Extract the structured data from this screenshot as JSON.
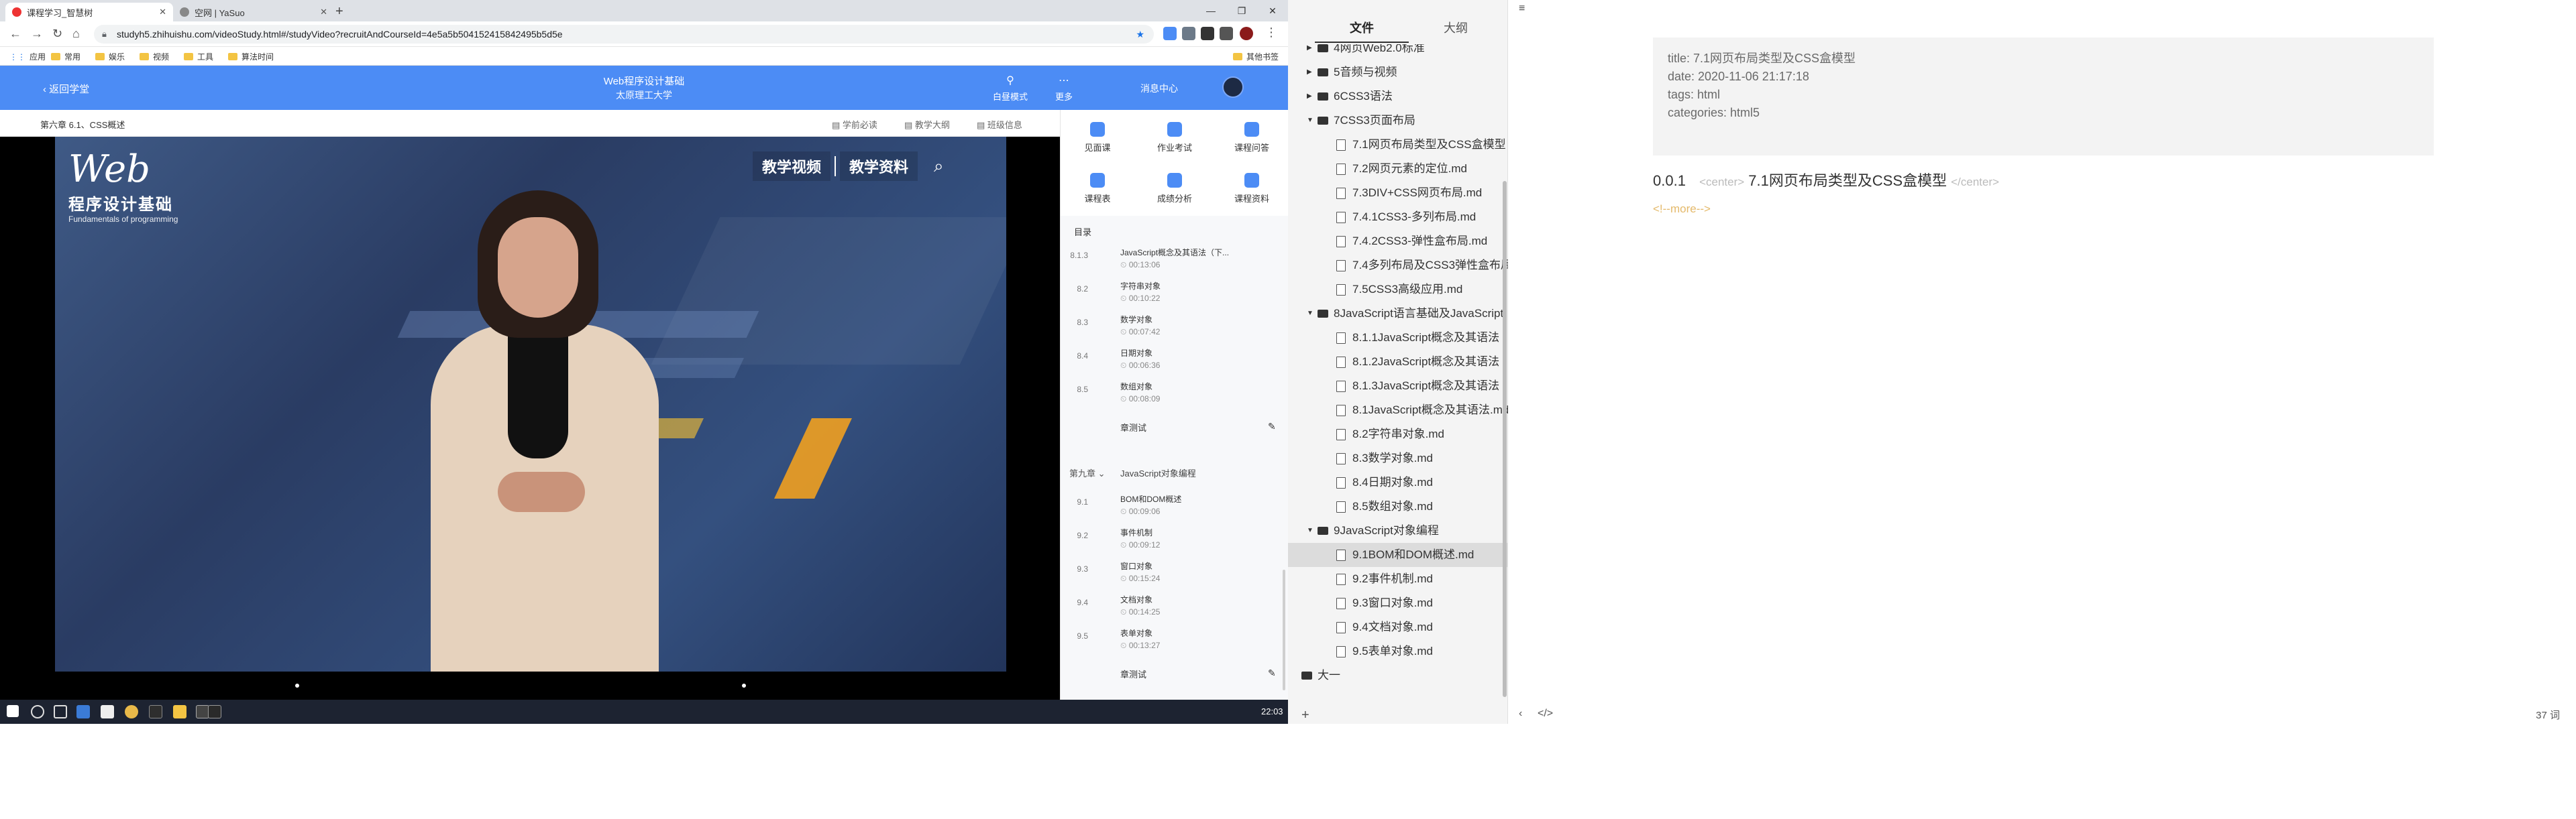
{
  "browser": {
    "tabs": [
      {
        "title": "课程学习_智慧树",
        "icon": "zhihuishu-icon"
      },
      {
        "title": "空网 | YaSuo",
        "icon": "globe-icon"
      }
    ],
    "url": "studyh5.zhihuishu.com/videoStudy.html#/studyVideo?recruitAndCourseId=4e5a5b504152415842495b5d5e",
    "bookmarks": [
      "应用",
      "常用",
      "娱乐",
      "视频",
      "工具",
      "算法时间"
    ],
    "bookmarks_right": "其他书签"
  },
  "site": {
    "back_label": "返回学堂",
    "course_title": "Web程序设计基础",
    "school": "太原理工大学",
    "mode_label": "白昼模式",
    "more_label": "更多",
    "message_center": "消息中心"
  },
  "chapter_bar": {
    "crumb": "第六章 6.1、CSS概述",
    "buttons": [
      "学前必读",
      "教学大纲",
      "班级信息"
    ]
  },
  "video": {
    "logo_word": "Web",
    "logo_cn": "程序设计基础",
    "logo_en": "Fundamentals of programming",
    "tab1": "教学视频",
    "tab2": "教学资料",
    "search_icon": "search-icon"
  },
  "quick": [
    {
      "label": "见面课"
    },
    {
      "label": "作业考试"
    },
    {
      "label": "课程问答"
    },
    {
      "label": "课程表"
    },
    {
      "label": "成绩分析"
    },
    {
      "label": "课程资料"
    }
  ],
  "toc": {
    "heading": "目录",
    "sections_a": [
      {
        "num": "8.1.3",
        "title": "JavaScript概念及其语法（下...",
        "dur": "00:13:06"
      },
      {
        "num": "8.2",
        "title": "字符串对象",
        "dur": "00:10:22"
      },
      {
        "num": "8.3",
        "title": "数学对象",
        "dur": "00:07:42"
      },
      {
        "num": "8.4",
        "title": "日期对象",
        "dur": "00:06:36"
      },
      {
        "num": "8.5",
        "title": "数组对象",
        "dur": "00:08:09"
      }
    ],
    "test_label": "章测试",
    "chapter9": {
      "label": "第九章",
      "title": "JavaScript对象编程"
    },
    "sections_b": [
      {
        "num": "9.1",
        "title": "BOM和DOM概述",
        "dur": "00:09:06"
      },
      {
        "num": "9.2",
        "title": "事件机制",
        "dur": "00:09:12"
      },
      {
        "num": "9.3",
        "title": "窗口对象",
        "dur": "00:15:24"
      },
      {
        "num": "9.4",
        "title": "文档对象",
        "dur": "00:14:25"
      },
      {
        "num": "9.5",
        "title": "表单对象",
        "dur": "00:13:27"
      }
    ],
    "test_label2": "章测试"
  },
  "taskbar": {
    "clock": "22:03"
  },
  "typora": {
    "tabs": {
      "files": "文件",
      "outline": "大纲"
    },
    "tree": [
      {
        "type": "folder",
        "level": 1,
        "label": "4网页Web2.0标准",
        "open": false
      },
      {
        "type": "folder",
        "level": 1,
        "label": "5音频与视频",
        "open": false
      },
      {
        "type": "folder",
        "level": 1,
        "label": "6CSS3语法",
        "open": false
      },
      {
        "type": "folder",
        "level": 1,
        "label": "7CSS3页面布局",
        "open": true
      },
      {
        "type": "file",
        "level": 2,
        "label": "7.1网页布局类型及CSS盒模型"
      },
      {
        "type": "file",
        "level": 2,
        "label": "7.2网页元素的定位.md"
      },
      {
        "type": "file",
        "level": 2,
        "label": "7.3DIV+CSS网页布局.md"
      },
      {
        "type": "file",
        "level": 2,
        "label": "7.4.1CSS3-多列布局.md"
      },
      {
        "type": "file",
        "level": 2,
        "label": "7.4.2CSS3-弹性盒布局.md"
      },
      {
        "type": "file",
        "level": 2,
        "label": "7.4多列布局及CSS3弹性盒布局"
      },
      {
        "type": "file",
        "level": 2,
        "label": "7.5CSS3高级应用.md"
      },
      {
        "type": "folder",
        "level": 1,
        "label": "8JavaScript语言基础及JavaScript",
        "open": true
      },
      {
        "type": "file",
        "level": 2,
        "label": "8.1.1JavaScript概念及其语法"
      },
      {
        "type": "file",
        "level": 2,
        "label": "8.1.2JavaScript概念及其语法"
      },
      {
        "type": "file",
        "level": 2,
        "label": "8.1.3JavaScript概念及其语法"
      },
      {
        "type": "file",
        "level": 2,
        "label": "8.1JavaScript概念及其语法.md"
      },
      {
        "type": "file",
        "level": 2,
        "label": "8.2字符串对象.md"
      },
      {
        "type": "file",
        "level": 2,
        "label": "8.3数学对象.md"
      },
      {
        "type": "file",
        "level": 2,
        "label": "8.4日期对象.md"
      },
      {
        "type": "file",
        "level": 2,
        "label": "8.5数组对象.md"
      },
      {
        "type": "folder",
        "level": 1,
        "label": "9JavaScript对象编程",
        "open": true
      },
      {
        "type": "file",
        "level": 2,
        "label": "9.1BOM和DOM概述.md",
        "selected": true
      },
      {
        "type": "file",
        "level": 2,
        "label": "9.2事件机制.md"
      },
      {
        "type": "file",
        "level": 2,
        "label": "9.3窗口对象.md"
      },
      {
        "type": "file",
        "level": 2,
        "label": "9.4文档对象.md"
      },
      {
        "type": "file",
        "level": 2,
        "label": "9.5表单对象.md"
      },
      {
        "type": "folder",
        "level": 0,
        "label": "大一",
        "open": false
      }
    ],
    "frontmatter": [
      "title: 7.1网页布局类型及CSS盒模型",
      "date: 2020-11-06 21:17:18",
      "tags: html",
      "categories: html5"
    ],
    "heading_num": "0.0.1",
    "heading_open": "<center>",
    "heading_text": "7.1网页布局类型及CSS盒模型",
    "heading_close": "</center>",
    "more": "<!--more-->",
    "word_count": "37 词",
    "source_label": "</>"
  }
}
